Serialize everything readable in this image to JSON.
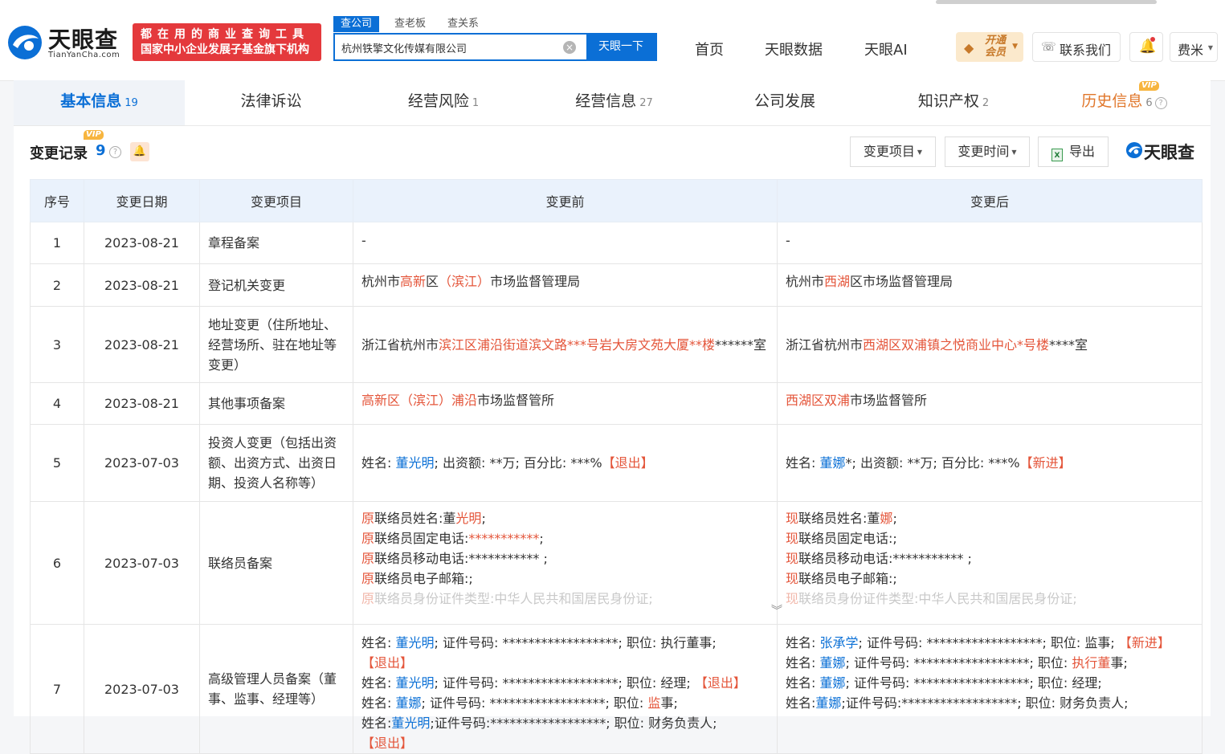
{
  "header": {
    "logo_cn": "天眼查",
    "logo_en": "TianYanCha.com",
    "promo_line1": "都在用的商业查询工具",
    "promo_line2": "国家中小企业发展子基金旗下机构",
    "search_tabs": [
      "查公司",
      "查老板",
      "查关系"
    ],
    "search_value": "杭州铁擎文化传媒有限公司",
    "search_button": "天眼一下",
    "nav": [
      "首页",
      "天眼数据",
      "天眼AI"
    ],
    "vip_button": "开通会员",
    "contact": "联系我们",
    "user": "费米"
  },
  "tabs": [
    {
      "label": "基本信息",
      "count": "19"
    },
    {
      "label": "法律诉讼",
      "count": ""
    },
    {
      "label": "经营风险",
      "count": "1"
    },
    {
      "label": "经营信息",
      "count": "27"
    },
    {
      "label": "公司发展",
      "count": ""
    },
    {
      "label": "知识产权",
      "count": "2"
    },
    {
      "label": "历史信息",
      "count": "6"
    }
  ],
  "vip_label": "VIP",
  "section": {
    "title": "变更记录",
    "count": "9",
    "tools": [
      "变更项目",
      "变更时间",
      "导出"
    ],
    "watermark": "天眼查"
  },
  "table": {
    "headers": [
      "序号",
      "变更日期",
      "变更项目",
      "变更前",
      "变更后"
    ],
    "rows": [
      {
        "no": "1",
        "date": "2023-08-21",
        "item": "章程备案",
        "before": "-",
        "after": "-"
      },
      {
        "no": "2",
        "date": "2023-08-21",
        "item": "登记机关变更"
      },
      {
        "no": "3",
        "date": "2023-08-21",
        "item": "地址变更（住所地址、经营场所、驻在地址等变更）"
      },
      {
        "no": "4",
        "date": "2023-08-21",
        "item": "其他事项备案"
      },
      {
        "no": "5",
        "date": "2023-07-03",
        "item": "投资人变更（包括出资额、出资方式、出资日期、投资人名称等）"
      },
      {
        "no": "6",
        "date": "2023-07-03",
        "item": "联络员备案"
      },
      {
        "no": "7",
        "date": "2023-07-03",
        "item": "高级管理人员备案（董事、监事、经理等）"
      }
    ]
  }
}
